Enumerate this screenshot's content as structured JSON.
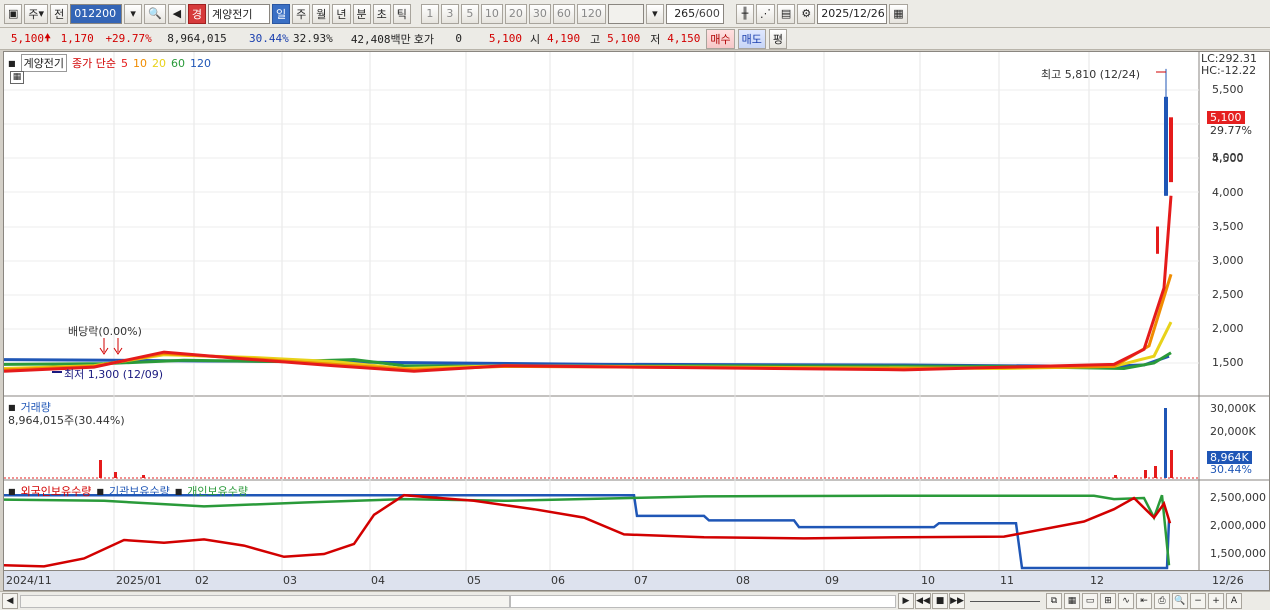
{
  "toolbar": {
    "period_type": "주",
    "prev_label": "전",
    "code": "012200",
    "stock_badge": "경",
    "stock_name": "계양전기",
    "periods": [
      "일",
      "주",
      "월",
      "년",
      "분",
      "초",
      "틱"
    ],
    "minute_values": [
      "1",
      "3",
      "5",
      "10",
      "20",
      "30",
      "60",
      "120"
    ],
    "count": "265",
    "count_total": "/600",
    "date": "2025/12/26"
  },
  "quote": {
    "price": "5,100",
    "change": "1,170",
    "change_pct": "+29.77%",
    "volume": "8,964,015",
    "vol_ratio": "30.44%",
    "turnover": "32.93%",
    "amount": "42,408백만",
    "hoga_label": "호가",
    "hoga_value": "0",
    "hoga_price": "5,100",
    "open_label": "시",
    "open": "4,190",
    "high_label": "고",
    "high": "5,100",
    "low_label": "저",
    "low": "4,150",
    "buy": "매수",
    "sell": "매도",
    "eval": "평"
  },
  "price_panel": {
    "legend_name": "계양전기",
    "legend_ma": "종가 단순",
    "ma_periods": [
      {
        "label": "5",
        "color": "#e51b1b"
      },
      {
        "label": "10",
        "color": "#f08c00"
      },
      {
        "label": "20",
        "color": "#e8d21a"
      },
      {
        "label": "60",
        "color": "#2a9a3a"
      },
      {
        "label": "120",
        "color": "#1f56b6"
      }
    ],
    "lc": "LC:292.31",
    "hc": "HC:-12.22",
    "high_note": "최고 5,810 (12/24)",
    "low_note": "최저 1,300 (12/09)",
    "dividend_note": "배당락(0.00%)",
    "price_tag": "5,100",
    "pct_tag": "29.77%",
    "y_ticks": [
      "5,500",
      "5,000",
      "4,500",
      "4,000",
      "3,500",
      "3,000",
      "2,500",
      "2,000",
      "1,500"
    ]
  },
  "volume_panel": {
    "title": "거래량",
    "value": "8,964,015주(30.44%)",
    "tag": "8,964K",
    "pct": "30.44%",
    "y_ticks": [
      "30,000K",
      "20,000K",
      "10,000K"
    ]
  },
  "holding_panel": {
    "legend": [
      {
        "label": "외국인보유수량",
        "color": "#d20000"
      },
      {
        "label": "기관보유수량",
        "color": "#1f56b6"
      },
      {
        "label": "개인보유수량",
        "color": "#2a9a3a"
      }
    ],
    "y_ticks": [
      "2,500,000",
      "2,000,000",
      "1,500,000"
    ]
  },
  "x_axis": [
    "2024/11",
    "2025/01",
    "02",
    "03",
    "04",
    "05",
    "06",
    "07",
    "08",
    "09",
    "10",
    "11",
    "12",
    "12/26"
  ]
}
